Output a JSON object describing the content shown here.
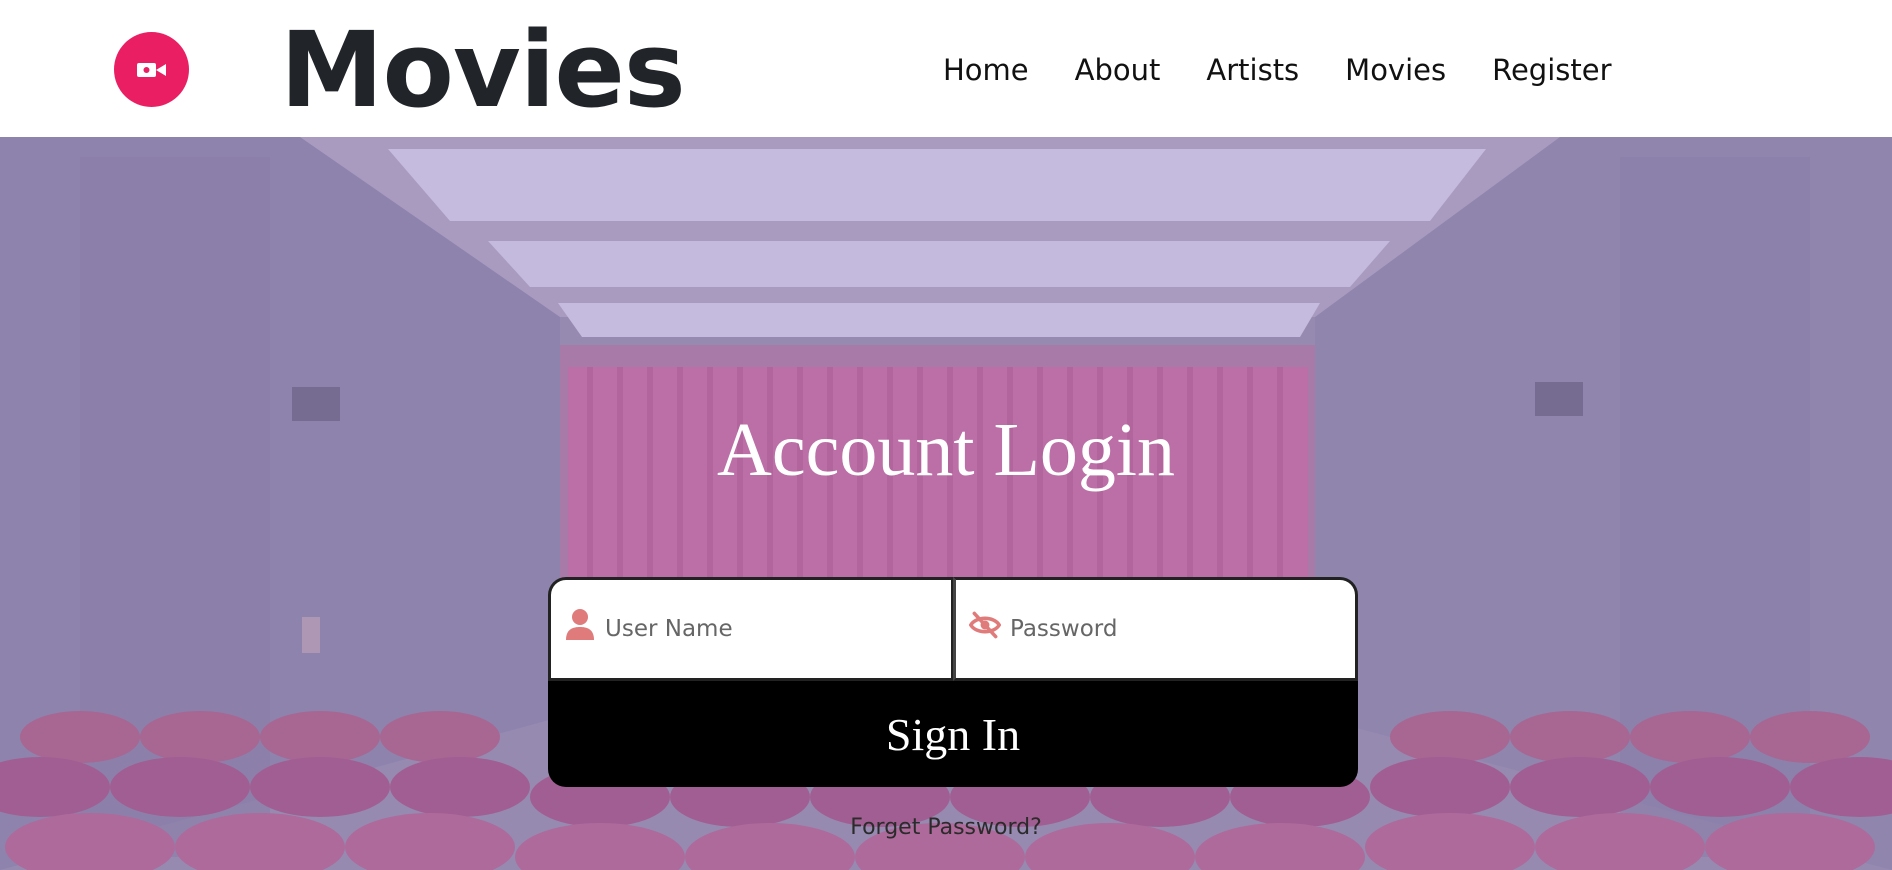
{
  "brand": {
    "name": "Movies",
    "logo_icon": "video-camera-icon",
    "accent": "#e91e63"
  },
  "nav": {
    "items": [
      "Home",
      "About",
      "Artists",
      "Movies",
      "Register"
    ]
  },
  "login": {
    "title": "Account Login",
    "username_placeholder": "User Name",
    "password_placeholder": "Password",
    "username_icon": "user-icon",
    "password_icon": "eye-slash-icon",
    "signin_label": "Sign In",
    "forgot_label": "Forget Password?"
  }
}
